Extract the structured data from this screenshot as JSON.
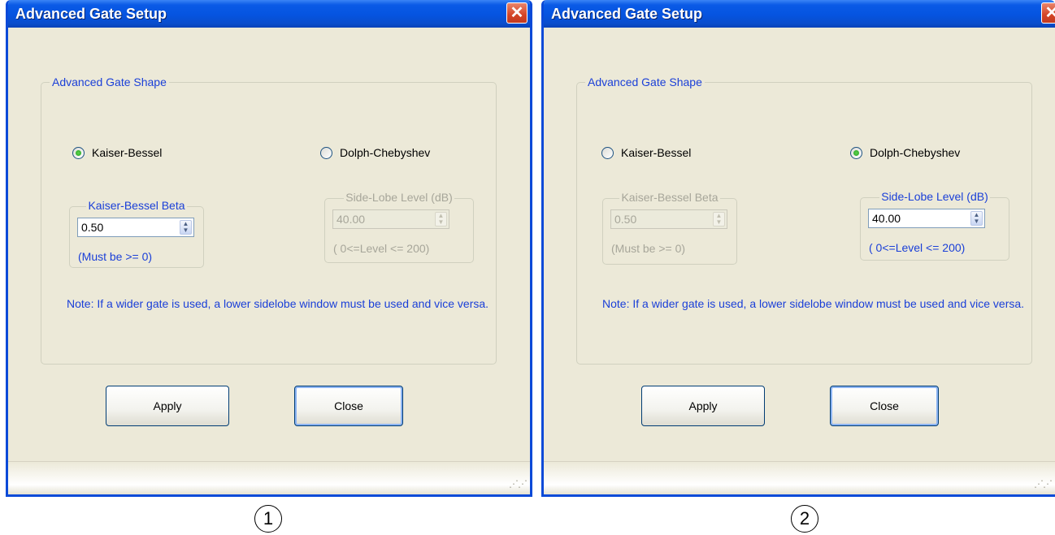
{
  "dialogs": [
    {
      "title": "Advanced Gate Setup",
      "group_title": "Advanced Gate Shape",
      "radio_kaiser": {
        "label": "Kaiser-Bessel",
        "checked": true
      },
      "radio_dolph": {
        "label": "Dolph-Chebyshev",
        "checked": false
      },
      "kaiser_group": {
        "title": "Kaiser-Bessel Beta",
        "value": "0.50",
        "hint": "(Must be >= 0)",
        "enabled": true
      },
      "sidelobe_group": {
        "title": "Side-Lobe Level (dB)",
        "value": "40.00",
        "hint": "( 0<=Level <= 200)",
        "enabled": false
      },
      "note": "Note: If a wider gate is used, a lower sidelobe window must be used and vice versa.",
      "apply_label": "Apply",
      "close_label": "Close",
      "close_icon": "close-x-icon"
    },
    {
      "title": "Advanced Gate Setup",
      "group_title": "Advanced Gate Shape",
      "radio_kaiser": {
        "label": "Kaiser-Bessel",
        "checked": false
      },
      "radio_dolph": {
        "label": "Dolph-Chebyshev",
        "checked": true
      },
      "kaiser_group": {
        "title": "Kaiser-Bessel Beta",
        "value": "0.50",
        "hint": "(Must be >= 0)",
        "enabled": false
      },
      "sidelobe_group": {
        "title": "Side-Lobe Level (dB)",
        "value": "40.00",
        "hint": "( 0<=Level <= 200)",
        "enabled": true
      },
      "note": "Note: If a wider gate is used, a lower sidelobe window must be used and vice versa.",
      "apply_label": "Apply",
      "close_label": "Close",
      "close_icon": "close-x-icon"
    }
  ],
  "step_labels": [
    "1",
    "2"
  ],
  "colors": {
    "titlebar": "#0554e0",
    "dialog_bg": "#ece9d8",
    "accent_text": "#1a3fd8",
    "radio_checked": "#21a121"
  }
}
